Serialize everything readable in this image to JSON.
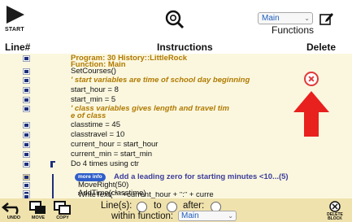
{
  "toolbar": {
    "start_label": "START",
    "function_select": "Main",
    "functions_label": "Functions"
  },
  "header": {
    "line_col": "Line#",
    "instructions_col": "Instructions",
    "delete_col": "Delete"
  },
  "lines": [
    {
      "text": "Program: 30 History::LittleRock",
      "style": "prog"
    },
    {
      "text": "Function: Main",
      "style": "prog"
    },
    {
      "text": "SetCourses()",
      "style": "code"
    },
    {
      "text": "' start variables are time of school day beginning",
      "style": "cmt"
    },
    {
      "text": "start_hour = 8",
      "style": "code"
    },
    {
      "text": "start_min = 5",
      "style": "code"
    },
    {
      "text": "' class variables gives length and travel tim",
      "style": "cmt"
    },
    {
      "text": "e of class",
      "style": "cmt"
    },
    {
      "text": "classtime = 45",
      "style": "code"
    },
    {
      "text": "classtravel = 10",
      "style": "code"
    },
    {
      "text": "current_hour = start_hour",
      "style": "code"
    },
    {
      "text": "current_min = start_min",
      "style": "code"
    },
    {
      "text": "Do 4 times using ctr",
      "style": "code"
    },
    {
      "text": "AddTime(classtime)",
      "style": "code"
    },
    {
      "text": "MoveRight(50)",
      "style": "code"
    },
    {
      "text": "WriteText( \" \"+current_hour + \":\" + curre",
      "style": "code"
    }
  ],
  "suggestion": {
    "pill_label": "more info",
    "text": "Add a leading zero for starting minutes <10...(5)"
  },
  "bottom": {
    "undo_label": "UNDO",
    "move_label": "MOVE",
    "copy_label": "COPY",
    "lines_label": "Line(s):",
    "to_label": "to",
    "after_label": "after:",
    "within_label": "within function:",
    "within_select": "Main",
    "delete_block_label_1": "DELETE",
    "delete_block_label_2": "BLOCK"
  },
  "colors": {
    "list_background": "#fbf7df",
    "comment_text": "#b07a00",
    "accent_blue": "#1f5fbf",
    "delete_red": "#e03a3a",
    "toolbar_background": "#f0e2ad"
  }
}
